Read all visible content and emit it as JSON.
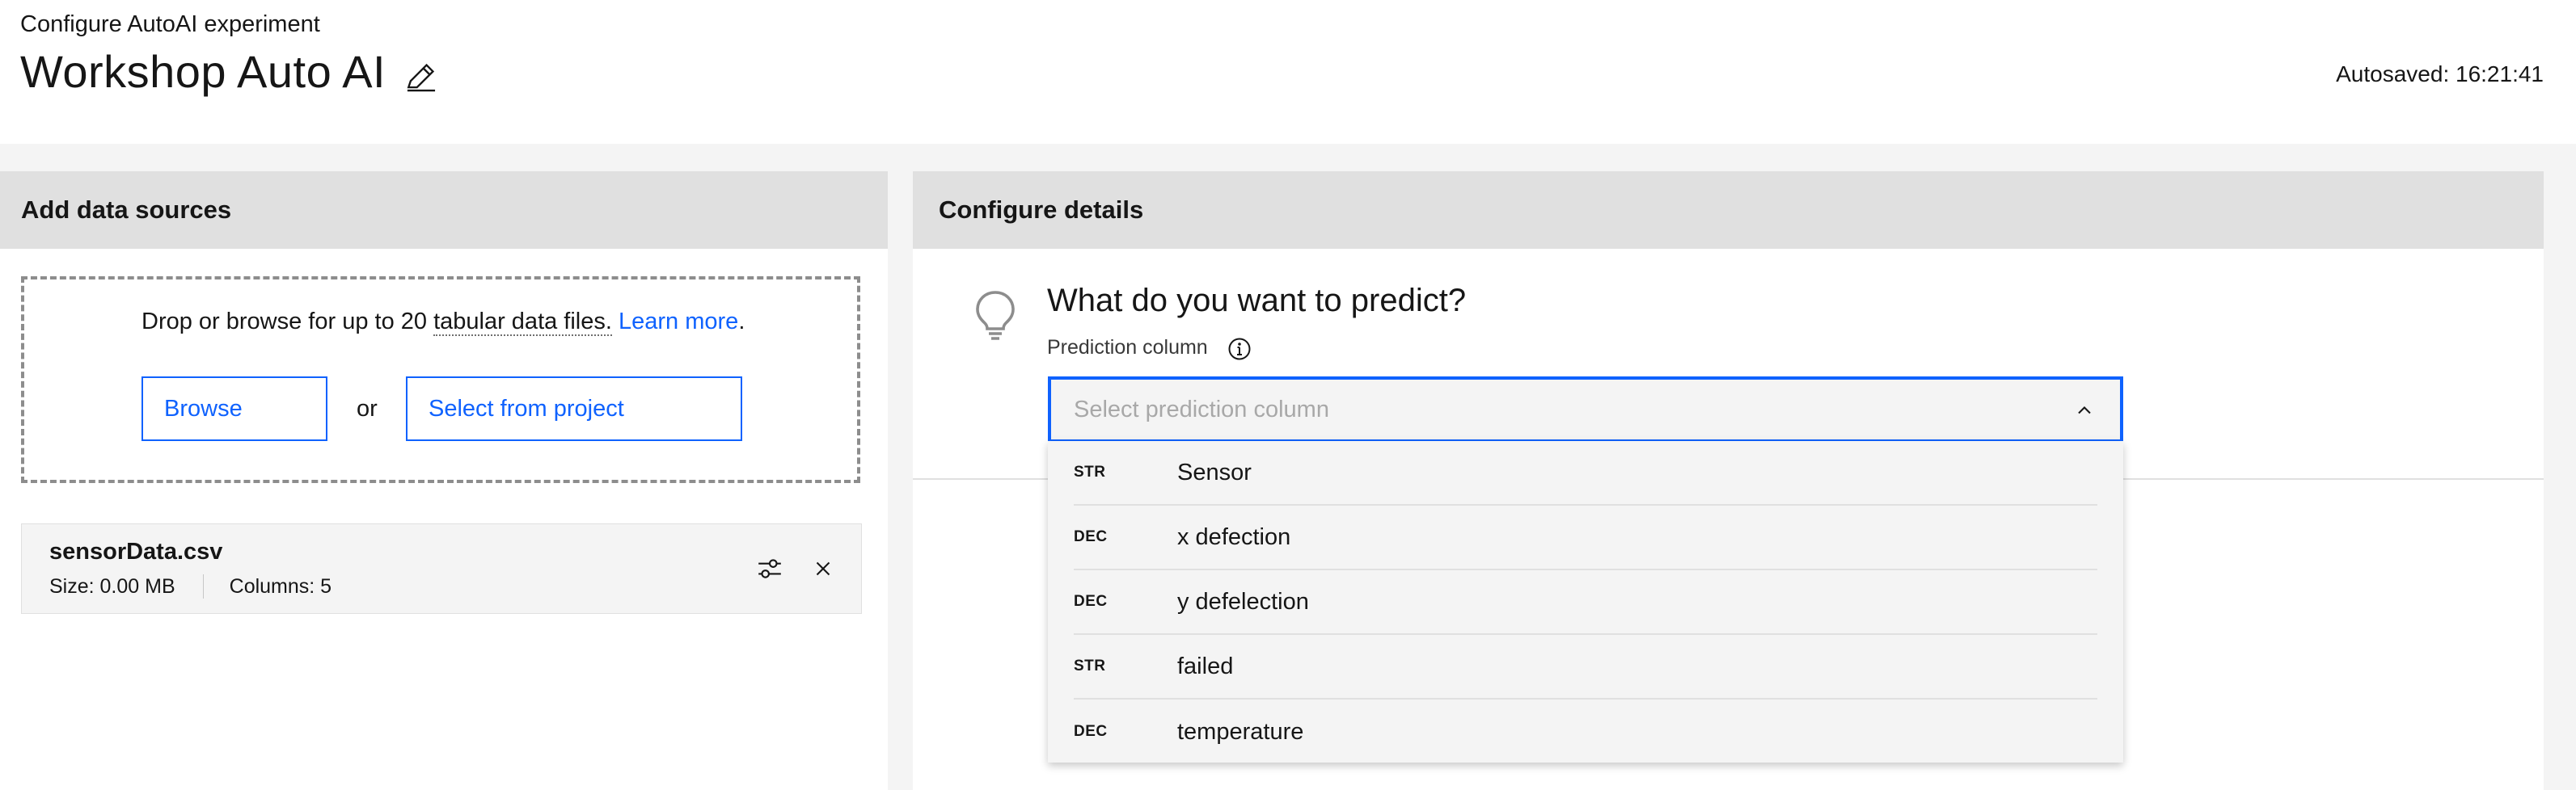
{
  "header": {
    "breadcrumb": "Configure AutoAI experiment",
    "title": "Workshop Auto AI",
    "autosaved": "Autosaved: 16:21:41"
  },
  "left_panel": {
    "title": "Add data sources",
    "drop_prefix": "Drop or browse for up to 20 ",
    "drop_link_dotted": "tabular data files.",
    "learn_more": "Learn more",
    "drop_suffix": ".",
    "browse_label": "Browse",
    "or_label": "or",
    "select_project_label": "Select from project",
    "file": {
      "name": "sensorData.csv",
      "size": "Size: 0.00 MB",
      "columns": "Columns: 5"
    }
  },
  "right_panel": {
    "title": "Configure details",
    "question": "What do you want to predict?",
    "prediction_label": "Prediction column",
    "select_placeholder": "Select prediction column",
    "options": [
      {
        "type": "STR",
        "label": "Sensor"
      },
      {
        "type": "DEC",
        "label": "x defection"
      },
      {
        "type": "DEC",
        "label": "y defelection"
      },
      {
        "type": "STR",
        "label": "failed"
      },
      {
        "type": "DEC",
        "label": "temperature"
      }
    ]
  },
  "colors": {
    "accent": "#0f62fe",
    "panel_header": "#e0e0e0",
    "background": "#f4f4f4"
  },
  "icons": [
    "edit-icon",
    "settings-icon",
    "close-icon",
    "lightbulb-icon",
    "info-icon",
    "chevron-up-icon"
  ]
}
